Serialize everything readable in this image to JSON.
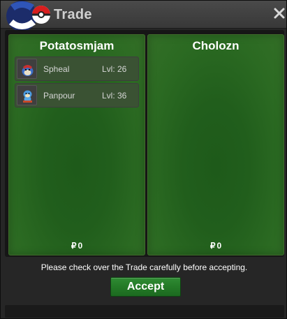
{
  "window": {
    "title": "Trade",
    "logo_icon": "pokeball-logo-icon",
    "close_icon": "close-icon"
  },
  "left": {
    "player": "Potatosmjam",
    "items": [
      {
        "name": "Spheal",
        "level": "Lvl: 26",
        "icon": "spheal-sprite-icon"
      },
      {
        "name": "Panpour",
        "level": "Lvl: 36",
        "icon": "panpour-sprite-icon"
      }
    ],
    "currency_symbol": "₽",
    "money": "0"
  },
  "right": {
    "player": "Cholozn",
    "items": [],
    "currency_symbol": "₽",
    "money": "0"
  },
  "notice": "Please check over the Trade carefully before accepting.",
  "accept_label": "Accept",
  "colors": {
    "panel_green": "#215e1c",
    "accept_green": "#237826",
    "window_bg": "#262626"
  }
}
